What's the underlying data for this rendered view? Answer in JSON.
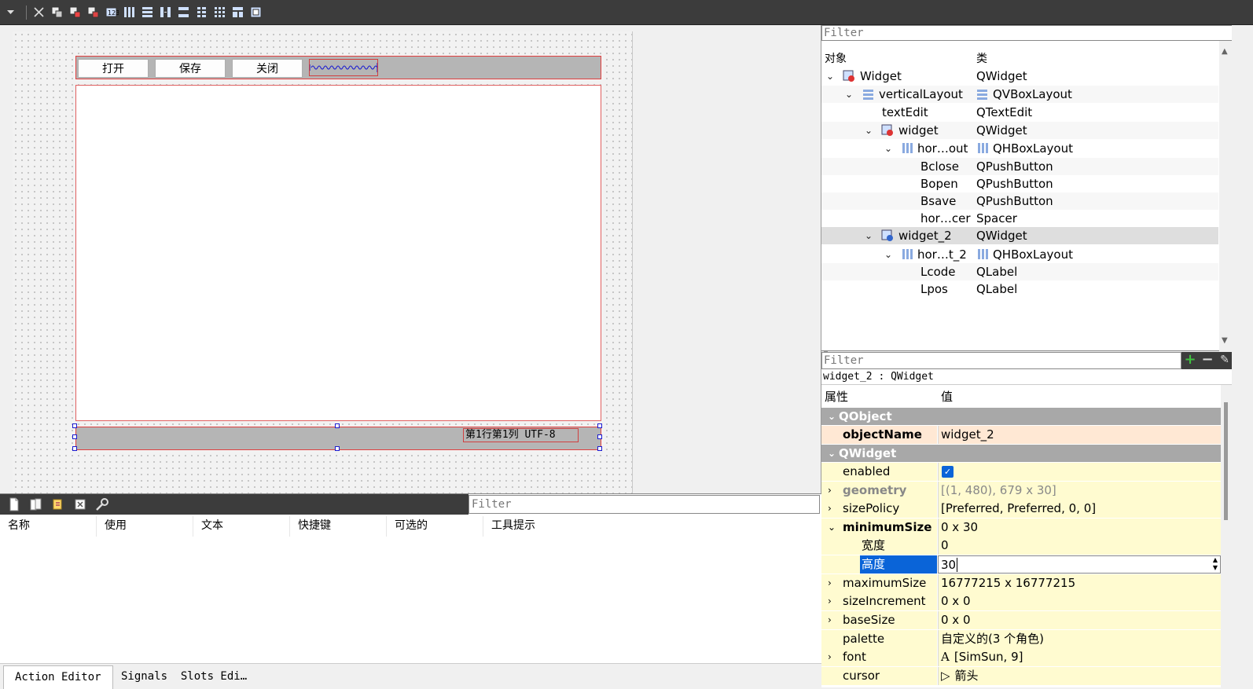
{
  "toolbar": {
    "icons": [
      "menu-arrow-icon",
      "close-tab-icon",
      "edit-widgets-icon",
      "edit-signals-icon",
      "edit-buddies-icon",
      "edit-tab-order-icon",
      "layout-horizontal-icon",
      "layout-vertical-icon",
      "splitter-horizontal-icon",
      "splitter-vertical-icon",
      "layout-form-icon",
      "layout-grid-icon",
      "break-layout-icon",
      "adjust-size-icon"
    ]
  },
  "form": {
    "buttons": [
      "打开",
      "保存",
      "关闭"
    ],
    "status_label": "第1行第1列 UTF-8"
  },
  "object_inspector": {
    "filter_placeholder": "Filter",
    "header_object": "对象",
    "header_class": "类",
    "rows": [
      {
        "name": "Widget",
        "cls": "QWidget"
      },
      {
        "name": "verticalLayout",
        "cls": "QVBoxLayout"
      },
      {
        "name": "textEdit",
        "cls": "QTextEdit"
      },
      {
        "name": "widget",
        "cls": "QWidget"
      },
      {
        "name": "hor…out",
        "cls": "QHBoxLayout"
      },
      {
        "name": "Bclose",
        "cls": "QPushButton"
      },
      {
        "name": "Bopen",
        "cls": "QPushButton"
      },
      {
        "name": "Bsave",
        "cls": "QPushButton"
      },
      {
        "name": "hor…cer",
        "cls": "Spacer"
      },
      {
        "name": "widget_2",
        "cls": "QWidget"
      },
      {
        "name": "hor…t_2",
        "cls": "QHBoxLayout"
      },
      {
        "name": "Lcode",
        "cls": "QLabel"
      },
      {
        "name": "Lpos",
        "cls": "QLabel"
      }
    ],
    "selected": "widget_2"
  },
  "property_editor": {
    "filter_placeholder": "Filter",
    "title": "widget_2 : QWidget",
    "header_property": "属性",
    "header_value": "值",
    "rows": [
      {
        "key": "QObject",
        "value": ""
      },
      {
        "key": "objectName",
        "value": "widget_2"
      },
      {
        "key": "QWidget",
        "value": ""
      },
      {
        "key": "enabled",
        "value": ""
      },
      {
        "key": "geometry",
        "value": "[(1, 480), 679 x 30]"
      },
      {
        "key": "sizePolicy",
        "value": "[Preferred, Preferred, 0, 0]"
      },
      {
        "key": "minimumSize",
        "value": "0 x 30"
      },
      {
        "key": "宽度",
        "value": "0"
      },
      {
        "key": "高度",
        "value": "30"
      },
      {
        "key": "maximumSize",
        "value": "16777215 x 16777215"
      },
      {
        "key": "sizeIncrement",
        "value": "0 x 0"
      },
      {
        "key": "baseSize",
        "value": "0 x 0"
      },
      {
        "key": "palette",
        "value": "自定义的(3 个角色)"
      },
      {
        "key": "font",
        "value": "[SimSun, 9]"
      },
      {
        "key": "cursor",
        "value": "箭头"
      }
    ],
    "enabled_checked": true
  },
  "action_editor": {
    "filter_placeholder": "Filter",
    "columns": [
      "名称",
      "使用",
      "文本",
      "快捷键",
      "可选的",
      "工具提示"
    ],
    "tabs": [
      "Action Editor",
      "Signals  Slots Edi…"
    ]
  }
}
